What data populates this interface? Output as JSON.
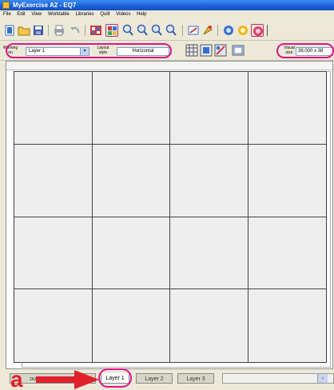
{
  "window": {
    "title": "MyExercise A2 - EQ7"
  },
  "menu": [
    "File",
    "Edit",
    "View",
    "Worktable",
    "Libraries",
    "Quilt",
    "Videos",
    "Help"
  ],
  "toolbar": {
    "icons": [
      "new-icon",
      "open-icon",
      "save-icon",
      "print-icon",
      "undo-icon",
      "sketchbook-icon",
      "color-palette-icon",
      "zoom-in-icon",
      "zoom-out-icon",
      "zoom-fit-icon",
      "zoom-page-icon",
      "edit-quilt-icon",
      "adjust-tool-icon",
      "blue-circle-icon",
      "yellow-circle-icon",
      "pink-circle-icon"
    ]
  },
  "options": {
    "working_on_label": "Working on",
    "working_on_value": "Layer 1",
    "layout_style_label": "Layout style",
    "layout_style_value": "Horizontal",
    "visual_size_label": "Visual size",
    "visual_size_value": "38.000 x 38"
  },
  "layers": {
    "partial_tab": "out",
    "tabs": [
      "Layer 1",
      "Layer 2",
      "Layer 3"
    ],
    "active": "Layer 1"
  },
  "annotation": {
    "letter": "a",
    "color": "#e0202a",
    "highlight_color": "#e0148c"
  },
  "grid": {
    "rows": 4,
    "cols": 4
  }
}
